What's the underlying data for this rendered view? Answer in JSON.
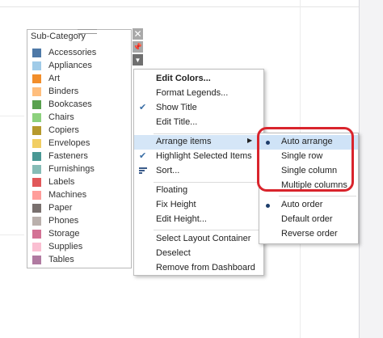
{
  "legend": {
    "title": "Sub-Category",
    "items": [
      {
        "label": "Accessories",
        "color": "#4e79a7"
      },
      {
        "label": "Appliances",
        "color": "#a0cbe8"
      },
      {
        "label": "Art",
        "color": "#f28e2b"
      },
      {
        "label": "Binders",
        "color": "#ffbe7d"
      },
      {
        "label": "Bookcases",
        "color": "#59a14f"
      },
      {
        "label": "Chairs",
        "color": "#8cd17d"
      },
      {
        "label": "Copiers",
        "color": "#b6992d"
      },
      {
        "label": "Envelopes",
        "color": "#f1ce63"
      },
      {
        "label": "Fasteners",
        "color": "#499894"
      },
      {
        "label": "Furnishings",
        "color": "#86bcb6"
      },
      {
        "label": "Labels",
        "color": "#e15759"
      },
      {
        "label": "Machines",
        "color": "#ff9d9a"
      },
      {
        "label": "Paper",
        "color": "#79706e"
      },
      {
        "label": "Phones",
        "color": "#bab0ac"
      },
      {
        "label": "Storage",
        "color": "#d37295"
      },
      {
        "label": "Supplies",
        "color": "#fabfd2"
      },
      {
        "label": "Tables",
        "color": "#b07aa1"
      }
    ]
  },
  "legend_controls": {
    "close_icon": "close-icon",
    "pin_icon": "pin-icon",
    "dropdown_icon": "dropdown-arrow-icon"
  },
  "context_menu": {
    "edit_colors": "Edit Colors...",
    "format_legends": "Format Legends...",
    "show_title": "Show Title",
    "edit_title": "Edit Title...",
    "arrange_items": "Arrange items",
    "highlight_selected": "Highlight Selected Items",
    "sort": "Sort...",
    "floating": "Floating",
    "fix_height": "Fix Height",
    "edit_height": "Edit Height...",
    "select_layout_container": "Select Layout Container",
    "deselect": "Deselect",
    "remove_from_dashboard": "Remove from Dashboard"
  },
  "arrange_submenu": {
    "auto_arrange": "Auto arrange",
    "single_row": "Single row",
    "single_column": "Single column",
    "multiple_columns": "Multiple columns",
    "auto_order": "Auto order",
    "default_order": "Default order",
    "reverse_order": "Reverse order"
  },
  "colors": {
    "highlight": "#d5e6f7",
    "annotation_outline": "#d9242c",
    "check": "#3a6ea5"
  }
}
